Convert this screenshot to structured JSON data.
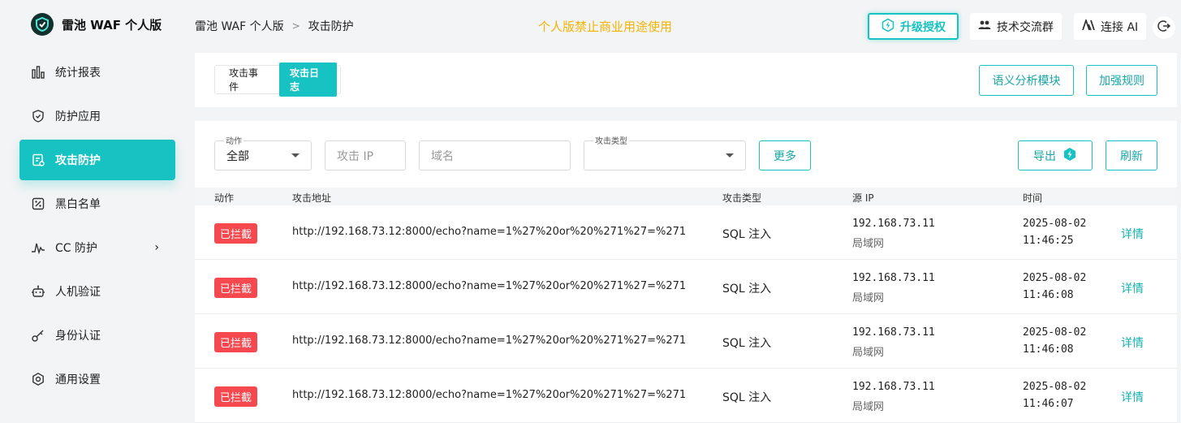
{
  "brand": {
    "title": "雷池 WAF 个人版"
  },
  "sidebar": {
    "items": [
      {
        "label": "统计报表",
        "icon": "chart-bars-icon"
      },
      {
        "label": "防护应用",
        "icon": "shield-icon"
      },
      {
        "label": "攻击防护",
        "icon": "clipboard-icon",
        "active": true
      },
      {
        "label": "黑白名单",
        "icon": "percent-tag-icon"
      },
      {
        "label": "CC 防护",
        "icon": "pulse-icon",
        "chevron": "›"
      },
      {
        "label": "人机验证",
        "icon": "robot-icon"
      },
      {
        "label": "身份认证",
        "icon": "key-icon"
      },
      {
        "label": "通用设置",
        "icon": "gear-icon"
      }
    ]
  },
  "header": {
    "breadcrumb": [
      "雷池 WAF 个人版",
      "攻击防护"
    ],
    "breadcrumb_sep": ">",
    "notice": "个人版禁止商业用途使用",
    "upgrade_label": "升级授权",
    "community_label": "技术交流群",
    "ai_label": "连接 AI"
  },
  "tabs": {
    "events": "攻击事件",
    "logs": "攻击日志"
  },
  "actions": {
    "semantic": "语义分析模块",
    "enhance": "加强规则"
  },
  "filters": {
    "action_label": "动作",
    "action_value": "全部",
    "ip_placeholder": "攻击 IP",
    "domain_placeholder": "域名",
    "type_label": "攻击类型",
    "more": "更多",
    "export": "导出",
    "refresh": "刷新"
  },
  "table": {
    "headers": {
      "action": "动作",
      "url": "攻击地址",
      "type": "攻击类型",
      "ip": "源 IP",
      "time": "时间"
    },
    "rows": [
      {
        "action": "已拦截",
        "url": "http://192.168.73.12:8000/echo?name=1%27%20or%20%271%27=%271",
        "type": "SQL 注入",
        "ip": "192.168.73.11",
        "net": "局域网",
        "date": "2025-08-02",
        "time": "11:46:25",
        "detail": "详情"
      },
      {
        "action": "已拦截",
        "url": "http://192.168.73.12:8000/echo?name=1%27%20or%20%271%27=%271",
        "type": "SQL 注入",
        "ip": "192.168.73.11",
        "net": "局域网",
        "date": "2025-08-02",
        "time": "11:46:08",
        "detail": "详情"
      },
      {
        "action": "已拦截",
        "url": "http://192.168.73.12:8000/echo?name=1%27%20or%20%271%27=%271",
        "type": "SQL 注入",
        "ip": "192.168.73.11",
        "net": "局域网",
        "date": "2025-08-02",
        "time": "11:46:08",
        "detail": "详情"
      },
      {
        "action": "已拦截",
        "url": "http://192.168.73.12:8000/echo?name=1%27%20or%20%271%27=%271",
        "type": "SQL 注入",
        "ip": "192.168.73.11",
        "net": "局域网",
        "date": "2025-08-02",
        "time": "11:46:07",
        "detail": "详情"
      }
    ]
  },
  "colors": {
    "accent": "#16c2c2",
    "danger": "#f5484f",
    "notice": "#f5b400"
  }
}
